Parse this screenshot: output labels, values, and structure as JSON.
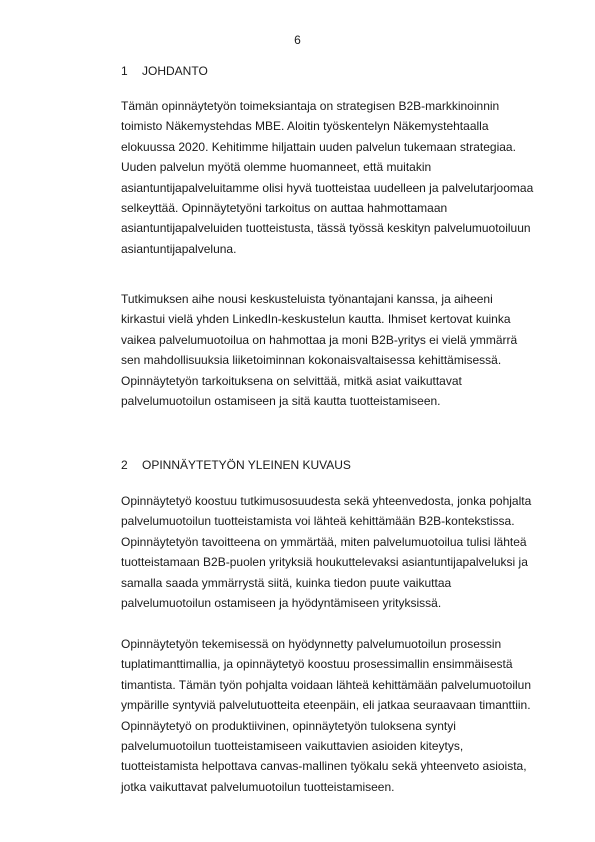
{
  "page_number": "6",
  "sections": [
    {
      "number": "1",
      "title": "JOHDANTO",
      "paragraphs": [
        [
          "Tämän opinnäytetyön toimeksiantaja on strategisen B2B-markkinoinnin",
          "toimisto Näkemystehdas MBE. Aloitin työskentelyn Näkemystehtaalla",
          "elokuussa 2020. Kehitimme hiljattain uuden palvelun tukemaan strategiaa.",
          "Uuden palvelun myötä olemme huomanneet, että muitakin",
          "asiantuntijapalveluitamme olisi hyvä tuotteistaa uudelleen ja palvelutarjoomaa",
          "selkeyttää. Opinnäytetyöni tarkoitus on auttaa hahmottamaan",
          "asiantuntijapalveluiden tuotteistusta, tässä työssä keskityn palvelumuotoiluun",
          "asiantuntijapalveluna."
        ],
        [
          "Tutkimuksen aihe nousi keskusteluista työnantajani kanssa, ja aiheeni",
          "kirkastui vielä yhden LinkedIn-keskustelun kautta. Ihmiset kertovat kuinka",
          "vaikea palvelumuotoilua on hahmottaa ja moni B2B-yritys ei vielä ymmärrä",
          "sen mahdollisuuksia liiketoiminnan kokonaisvaltaisessa kehittämisessä.",
          "Opinnäytetyön tarkoituksena on selvittää, mitkä asiat vaikuttavat",
          "palvelumuotoilun ostamiseen ja sitä kautta tuotteistamiseen."
        ]
      ]
    },
    {
      "number": "2",
      "title": "OPINNÄYTETYÖN YLEINEN KUVAUS",
      "paragraphs": [
        [
          "Opinnäytetyö koostuu tutkimusosuudesta sekä yhteenvedosta, jonka pohjalta",
          "palvelumuotoilun tuotteistamista voi lähteä kehittämään B2B-kontekstissa.",
          "Opinnäytetyön tavoitteena on ymmärtää, miten palvelumuotoilua tulisi lähteä",
          "tuotteistamaan B2B-puolen yrityksiä houkuttelevaksi asiantuntijapalveluksi ja",
          "samalla saada ymmärrystä siitä, kuinka tiedon puute vaikuttaa",
          "palvelumuotoilun ostamiseen ja hyödyntämiseen yrityksissä."
        ],
        [
          "Opinnäytetyön tekemisessä on hyödynnetty palvelumuotoilun prosessin",
          "tuplatimanttimallia, ja opinnäytetyö koostuu prosessimallin ensimmäisestä",
          "timantista. Tämän työn pohjalta voidaan lähteä kehittämään palvelumuotoilun",
          "ympärille syntyviä palvelutuotteita eteenpäin, eli jatkaa seuraavaan timanttiin.",
          "Opinnäytetyö on produktiivinen, opinnäytetyön tuloksena syntyi",
          "palvelumuotoilun tuotteistamiseen vaikuttavien asioiden kiteytys,",
          "tuotteistamista helpottava canvas-mallinen työkalu sekä yhteenveto asioista,",
          "jotka vaikuttavat palvelumuotoilun tuotteistamiseen."
        ]
      ]
    }
  ]
}
